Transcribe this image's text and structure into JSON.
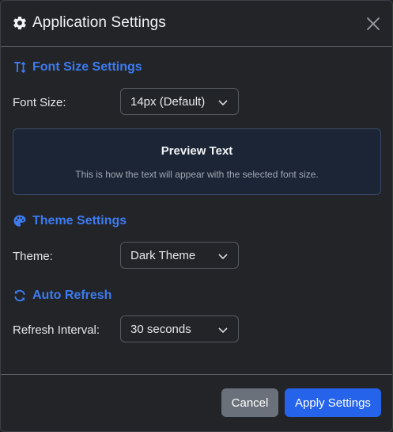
{
  "header": {
    "title": "Application Settings",
    "icon": "gear-icon",
    "close_icon": "close-icon"
  },
  "font_section": {
    "title": "Font Size Settings",
    "icon": "text-size-icon",
    "label": "Font Size:",
    "value": "14px (Default)",
    "preview_title": "Preview Text",
    "preview_desc": "This is how the text will appear with the selected font size."
  },
  "theme_section": {
    "title": "Theme Settings",
    "icon": "palette-icon",
    "label": "Theme:",
    "value": "Dark Theme"
  },
  "refresh_section": {
    "title": "Auto Refresh",
    "icon": "refresh-icon",
    "label": "Refresh Interval:",
    "value": "30 seconds"
  },
  "footer": {
    "cancel_label": "Cancel",
    "apply_label": "Apply Settings"
  },
  "colors": {
    "accent": "#3d7bf0",
    "primary_button": "#2563eb",
    "secondary_button": "#6b717a",
    "background": "#222428"
  }
}
